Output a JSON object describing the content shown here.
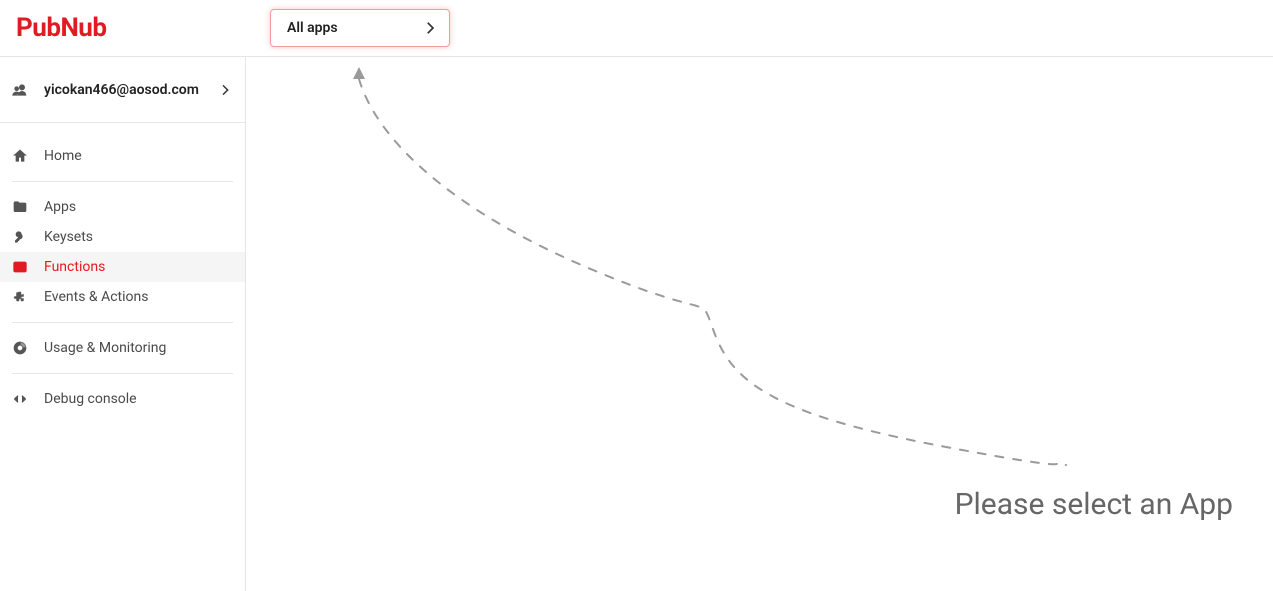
{
  "brand": "PubNub",
  "header": {
    "app_selector_label": "All apps"
  },
  "user": {
    "email": "yicokan466@aosod.com"
  },
  "sidebar": {
    "items": {
      "home": {
        "label": "Home"
      },
      "apps": {
        "label": "Apps"
      },
      "keysets": {
        "label": "Keysets"
      },
      "functions": {
        "label": "Functions"
      },
      "events": {
        "label": "Events & Actions"
      },
      "usage": {
        "label": "Usage & Monitoring"
      },
      "debug": {
        "label": "Debug console"
      }
    },
    "active": "functions"
  },
  "main": {
    "hint": "Please select an App"
  }
}
